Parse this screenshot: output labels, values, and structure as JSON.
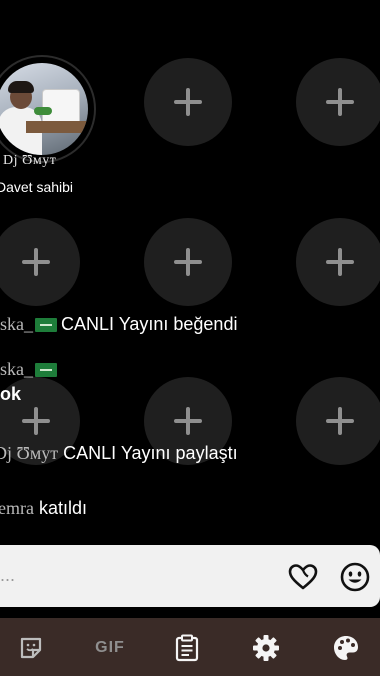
{
  "host": {
    "name": "Dj Ʊмут",
    "role": "Davet sahibi"
  },
  "chat": [
    {
      "user": "ska_",
      "message": "CANLI Yayını beğendi"
    },
    {
      "user": "ska_",
      "message": "ok"
    },
    {
      "user": "Dj Ʊмут",
      "message": "CANLI Yayını paylaştı"
    },
    {
      "user": "emra",
      "message": "katıldı"
    }
  ],
  "comment": {
    "placeholder": "..."
  },
  "toolbar": {
    "gif_label": "GIF"
  },
  "colors": {
    "background": "#000000",
    "seat": "#1f1f1f",
    "toolbar": "#3a2b27",
    "comment_bar": "#f1f1f1"
  }
}
